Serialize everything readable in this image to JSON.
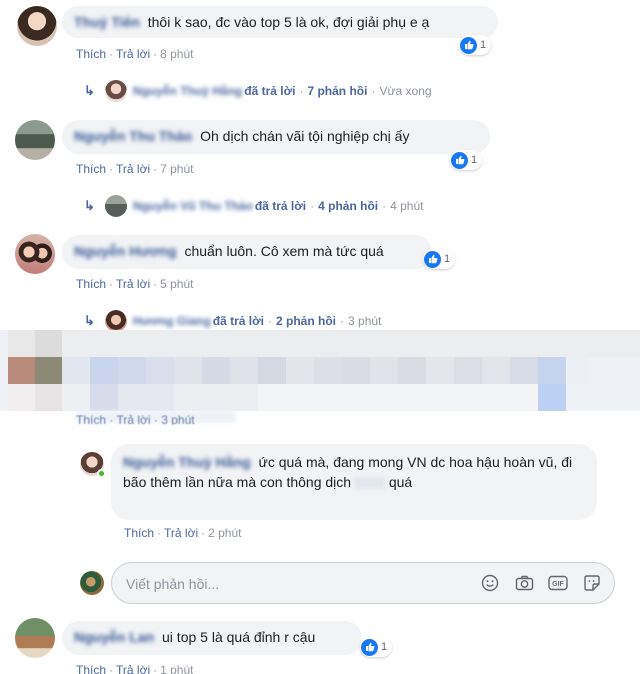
{
  "comments": [
    {
      "author": "Thuỷ Tiên",
      "text": "thôi k sao, đc vào top 5 là ok, đợi giải phụ e ạ",
      "reactions": "1",
      "actions": {
        "like": "Thích",
        "reply": "Trả lời",
        "time": "8 phút"
      },
      "reply_summary": {
        "name": "Nguyễn Thuỳ Hằng",
        "label": "đã trả lời",
        "count": "7 phản hồi",
        "time": "Vừa xong"
      }
    },
    {
      "author": "Nguyễn Thu Thảo",
      "text": "Oh dịch chán vãi tội nghiệp chị ấy",
      "reactions": "1",
      "actions": {
        "like": "Thích",
        "reply": "Trả lời",
        "time": "7 phút"
      },
      "reply_summary": {
        "name": "Nguyễn Vũ Thu Thảo",
        "label": "đã trả lời",
        "count": "4 phản hồi",
        "time": "4 phút"
      }
    },
    {
      "author": "Nguyễn Hương",
      "text": "chuẩn luôn. Cô xem mà tức quá",
      "reactions": "1",
      "actions": {
        "like": "Thích",
        "reply": "Trả lời",
        "time": "5 phút"
      },
      "reply_summary": {
        "name": "Hương Giang",
        "label": "đã trả lời",
        "count": "2 phản hồi",
        "time": "3 phút"
      }
    }
  ],
  "pixelated_row": {
    "actions_fragment": "Thích · Trả lời · 3 phút"
  },
  "nested_reply": {
    "author": "Nguyễn Thuỳ Hằng",
    "text": "ức quá mà, đang mong VN dc hoa hậu hoàn vũ, đi bão thêm lần nữa mà con thông dịch",
    "text_end": "quá",
    "actions": {
      "like": "Thích",
      "reply": "Trả lời",
      "time": "2 phút"
    }
  },
  "reply_input": {
    "placeholder": "Viết phản hồi...",
    "icons": [
      "emoji-icon",
      "camera-icon",
      "gif-icon",
      "sticker-icon"
    ]
  },
  "last_comment": {
    "author": "Nguyễn Lan",
    "text": "ui top 5 là quá đỉnh r cậu",
    "reactions": "1",
    "actions": {
      "like": "Thích",
      "reply": "Trả lời",
      "time": "1 phút"
    }
  },
  "colors": {
    "link": "#4b67a1",
    "name": "#385898",
    "bubble": "#f2f3f5",
    "meta": "#90949c",
    "like_blue": "#1877f2"
  }
}
